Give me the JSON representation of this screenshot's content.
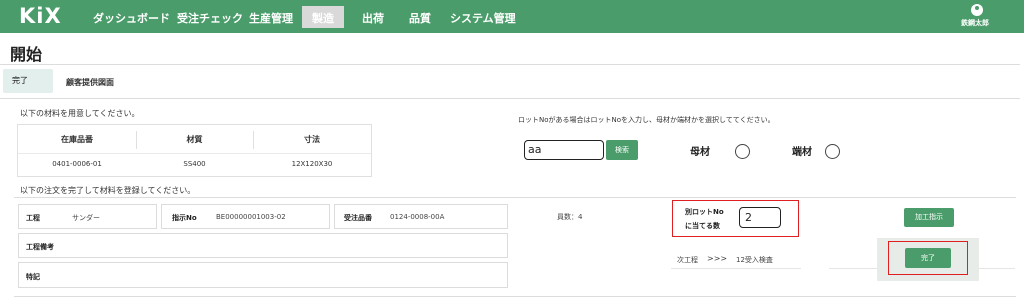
{
  "brand": {
    "logo": "KiX"
  },
  "nav": {
    "items": [
      "ダッシュボード",
      "受注チェック",
      "生産管理",
      "製造",
      "出荷",
      "品質",
      "システム管理"
    ],
    "active": "製造"
  },
  "user": {
    "name": "鉄鋼太郎"
  },
  "page": {
    "title": "開始"
  },
  "tabs": [
    "完了",
    "顧客提供図面"
  ],
  "materials": {
    "instruction": "以下の材料を用意してください。",
    "headers": [
      "在庫品番",
      "材質",
      "寸法"
    ],
    "row": [
      "0401-0006-01",
      "SS400",
      "12X120X30"
    ]
  },
  "lot": {
    "instruction": "ロットNoがある場合はロットNoを入力し、母材か端材かを選択しててください。",
    "input_value": "aa",
    "search_label": "検索",
    "base_material_label": "母材",
    "scrap_material_label": "端材"
  },
  "order": {
    "instruction": "以下の注文を完了して材料を登録してください。",
    "process_label": "工程",
    "process_value": "サンダー",
    "instruction_no_label": "指示No",
    "instruction_no_value": "BE00000001003-02",
    "order_part_label": "受注品番",
    "order_part_value": "0124-0008-00A",
    "count_text": "員数：4",
    "process_note_label": "工程備考",
    "special_note_label": "特記",
    "other_lot_label_line1": "別ロットNo",
    "other_lot_label_line2": "に当てる数",
    "other_lot_value": "2",
    "process_instruction_button": "加工指示",
    "next_process_label": "次工程",
    "next_process_arrow": ">>>",
    "next_process_value": "12受入検査",
    "complete_button": "完了"
  },
  "colors": {
    "accent": "#4a9d6a",
    "highlight": "#e02020"
  }
}
